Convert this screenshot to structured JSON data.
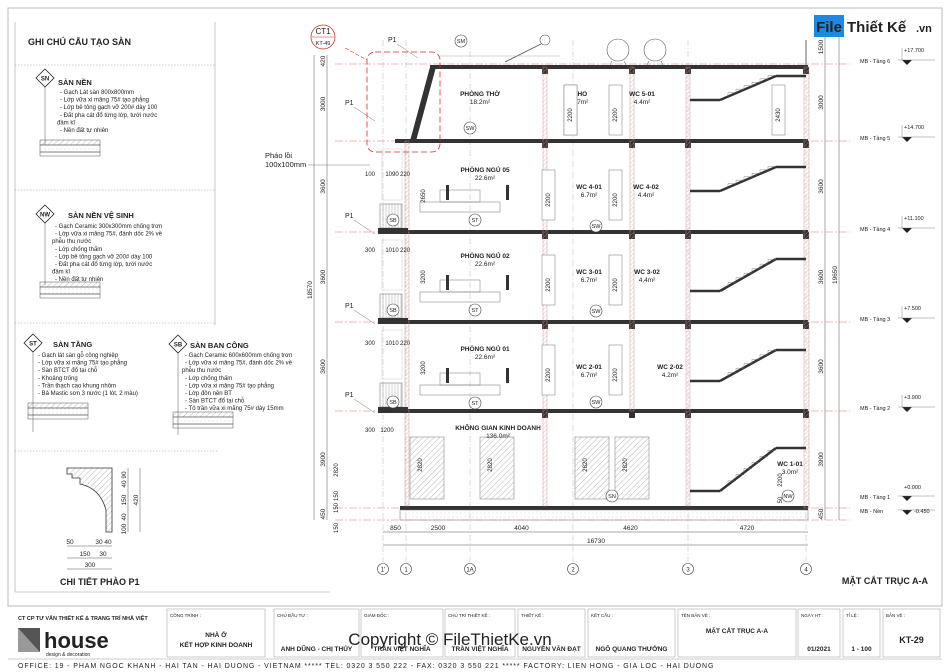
{
  "brand_logo": {
    "part1": "File",
    "part2": "Thiết Kế",
    "part3": ".vn",
    "color": "#1e88e5"
  },
  "watermark": "Copyright © FileThietKe.vn",
  "notes": {
    "title": "GHI CHÚ CẤU TẠO SÀN",
    "sections": [
      {
        "code": "SN",
        "title": "SÀN NỀN",
        "lines": [
          "- Gạch Lát sàn 800x800mm",
          "- Lớp vữa xi măng 75# tạo phẳng",
          "- Lớp bê tông gạch vỡ 200# dày 100",
          "- Đất pha cát đổ từng lớp, tưới nước",
          "đầm kĩ",
          "- Nền đất tự nhiên"
        ]
      },
      {
        "code": "NW",
        "title": "SÀN NỀN VỆ SINH",
        "lines": [
          "- Gạch Ceramic 300x300mm chống trơn",
          "- Lớp vữa xi măng 75#, đánh dốc 2% về",
          "phễu thu nước",
          "- Lớp chống thấm",
          "- Lớp bê tông gạch vỡ 200# dày 100",
          "- Đất pha cát đổ từng lớp, tưới nước",
          "đầm kĩ",
          "- Nền đất tự nhiên"
        ]
      },
      {
        "code": "ST",
        "title": "SÀN TẦNG",
        "lines": [
          "- Gạch lát sàn gỗ công nghiệp",
          "- Lớp vữa xi măng 75# tạo phẳng",
          "- Sàn BTCT đổ tại chỗ",
          "- Khoảng trống",
          "- Trần thạch cao khung nhôm",
          "- Bả Mastic sơn 3 nước (1 lót, 2 màu)"
        ]
      },
      {
        "code": "SB",
        "title": "SÀN BAN CÔNG",
        "lines": [
          "- Gạch Ceramic 600x600mm chống trơn",
          "- Lớp vữa xi măng 75#, đánh dốc 2% về",
          "phễu thu nước",
          "- Lớp chống thấm",
          "- Lớp vữa xi măng 75# tạo phẳng",
          "- Lớp đôn nền BT",
          "- Sàn BTCT đổ tại chỗ",
          "- Tô trần vữa xi măng 75# dày 15mm"
        ]
      }
    ]
  },
  "detail": {
    "title": "CHI TIẾT PHÀO P1",
    "vertical_dims": [
      "90",
      "40",
      "150",
      "40",
      "100"
    ],
    "total_height": "420",
    "bottom_dims_row1": [
      "50",
      "30",
      "40"
    ],
    "bottom_dims_row2": [
      "150",
      "30"
    ],
    "total_width": "300"
  },
  "drawing": {
    "title": "MẶT CẮT TRỤC A-A",
    "callout": {
      "code": "CT1",
      "ref": "KT-49",
      "color": "#d32f2f"
    },
    "cornice_label": "P1",
    "projection_label": [
      "Pháo lồi",
      "100x100mm"
    ],
    "rooms": [
      {
        "name": "PHÒNG THỜ",
        "area": "18.2m²"
      },
      {
        "name": "KHO",
        "area": "6.7m²"
      },
      {
        "name": "WC 5-01",
        "area": "4.4m²"
      },
      {
        "name": "PHÒNG NGỦ 05",
        "area": "22.6m²"
      },
      {
        "name": "WC 4-01",
        "area": "6.7m²"
      },
      {
        "name": "WC 4-02",
        "area": "4.4m²"
      },
      {
        "name": "PHÒNG NGỦ 02",
        "area": "22.6m²"
      },
      {
        "name": "WC 3-01",
        "area": "6.7m²"
      },
      {
        "name": "WC 3-02",
        "area": "4.4m²"
      },
      {
        "name": "PHÒNG NGỦ 01",
        "area": "22.6m²"
      },
      {
        "name": "WC 2-01",
        "area": "6.7m²"
      },
      {
        "name": "WC 2-02",
        "area": "4.2m²"
      },
      {
        "name": "KHÔNG GIAN KINH DOANH",
        "area": "136.0m²"
      },
      {
        "name": "WC 1-01",
        "area": "3.0m²"
      }
    ],
    "levels": [
      {
        "name": "MB - Tầng 6",
        "elev": "+17.700"
      },
      {
        "name": "MB - Tầng 5",
        "elev": "+14.700"
      },
      {
        "name": "MB - Tầng 4",
        "elev": "+11.100"
      },
      {
        "name": "MB - Tầng 3",
        "elev": "+7.500"
      },
      {
        "name": "MB - Tầng 2",
        "elev": "+3.900"
      },
      {
        "name": "MB - Tầng 1",
        "elev": "+0.000"
      },
      {
        "name": "MB - Nền",
        "elev": "-0.450"
      }
    ],
    "dims_left": [
      "420",
      "3000",
      "3600",
      "3600",
      "3600",
      "3900",
      "450"
    ],
    "dims_left_total": "18570",
    "dims_right": [
      "1500",
      "3000",
      "3600",
      "3600",
      "3600",
      "3900",
      "450"
    ],
    "dims_right_total": "19650",
    "dims_inner": [
      "2650",
      "3200",
      "3200",
      "2820",
      "150",
      "150",
      "150"
    ],
    "dims_balcony": [
      [
        "100",
        "1090",
        "220"
      ],
      [
        "300",
        "1010",
        "220"
      ],
      [
        "300",
        "1010",
        "220"
      ],
      [
        "300",
        "1200"
      ]
    ],
    "dims_bottom": [
      "850",
      "2500",
      "4040",
      "4620",
      "4720"
    ],
    "dims_bottom_total": "16730",
    "axes": [
      "1'",
      "1",
      "1A",
      "2",
      "3",
      "4"
    ],
    "door_labels": [
      "2200",
      "2200",
      "2430",
      "2200",
      "2200",
      "2200",
      "2200",
      "2200",
      "2200",
      "2200",
      "2820",
      "2820",
      "2820",
      "2820",
      "2200",
      "50"
    ],
    "tags": [
      "SM",
      "SW",
      "ST",
      "SB",
      "SW",
      "ST",
      "SB",
      "SW",
      "ST",
      "SB",
      "SW",
      "SN",
      "NW"
    ],
    "level_line_color": "#e57373"
  },
  "title_block": {
    "company": "CT CP TƯ VẤN THIẾT KẾ & TRANG TRÍ NHÀ VIỆT",
    "logo_main": "house",
    "logo_sub": "design & decoration",
    "cells": [
      {
        "label": "CÔNG TRÌNH :",
        "value": [
          "NHÀ Ở",
          "KẾT HỢP KINH DOANH"
        ]
      },
      {
        "label": "CHỦ ĐẦU TƯ :",
        "value": [
          "ANH DŨNG - CHỊ THỦY"
        ]
      },
      {
        "label": "GIÁM ĐỐC :",
        "value": [
          "TRẦN VIỆT NGHĨA"
        ]
      },
      {
        "label": "CHỦ TRÌ THIẾT KẾ :",
        "value": [
          "TRẦN VIỆT NGHĨA"
        ]
      },
      {
        "label": "THIẾT KẾ :",
        "value": [
          "NGUYỄN VĂN ĐẠT"
        ]
      },
      {
        "label": "KẾT CẤU :",
        "value": [
          "NGÔ QUANG THƯỞNG"
        ]
      },
      {
        "label": "TÊN BẢN VẼ :",
        "value": [
          "MẶT CẮT TRỤC A-A"
        ]
      },
      {
        "label": "NGÀY HT :",
        "value": [
          "01/2021"
        ]
      },
      {
        "label": "TỈ LỆ :",
        "value": [
          "1 - 100"
        ]
      },
      {
        "label": "BẢN VẼ :",
        "value": [
          "KT-29"
        ]
      }
    ],
    "footer": "OFFICE: 19 - PHAM NGOC KHANH - HAI TAN - HAI DUONG - VIETNAM  *****  TEL: 0320 3 550 222 - FAX: 0320 3 550 221  *****  FACTORY: LIEN HONG - GIA LOC - HAI DUONG"
  }
}
